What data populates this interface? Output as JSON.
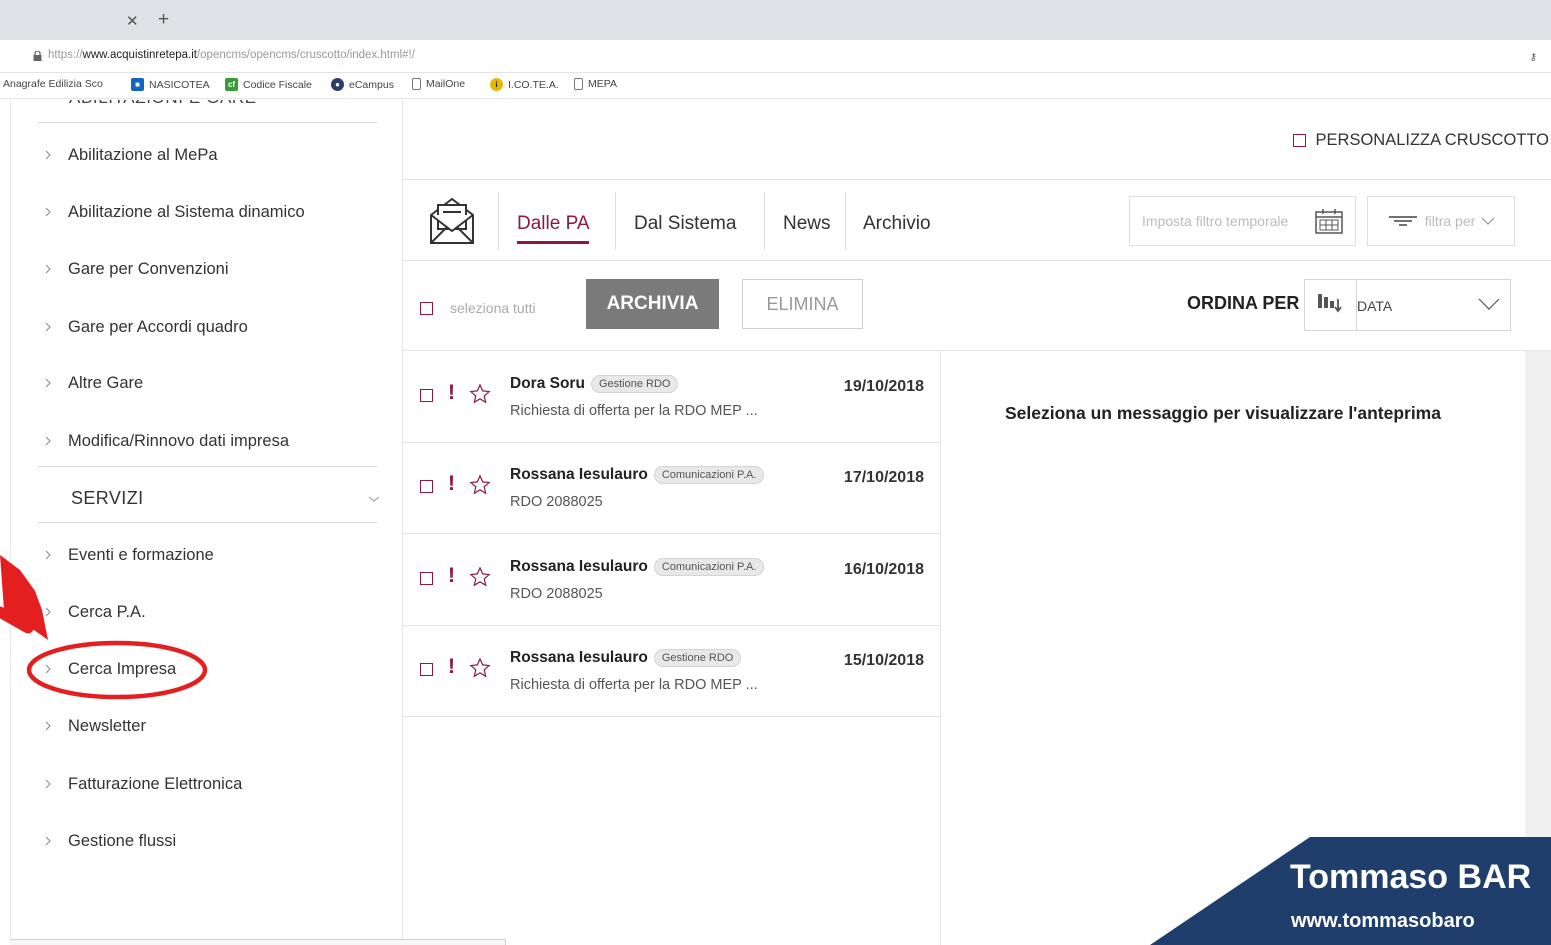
{
  "browser": {
    "url_prefix": "https://",
    "url_host": "www.acquistinretepa.it",
    "url_path": "/opencms/opencms/cruscotto/index.html#!/",
    "bookmarks": [
      {
        "label": "Anagrafe Edilizia Sco",
        "icon": "none"
      },
      {
        "label": "NASICOTEA",
        "icon": "nasicotea-icon"
      },
      {
        "label": "Codice Fiscale",
        "icon": "cf-icon"
      },
      {
        "label": "eCampus",
        "icon": "ecampus-icon"
      },
      {
        "label": "MailOne",
        "icon": "page-icon"
      },
      {
        "label": "I.CO.TE.A.",
        "icon": "icotea-icon"
      },
      {
        "label": "MEPA",
        "icon": "page-icon"
      }
    ]
  },
  "sidebar": {
    "cut_section": "ABILITAZIONI E GARE",
    "items_top": [
      "Abilitazione al MePa",
      "Abilitazione al Sistema dinamico",
      "Gare per Convenzioni",
      "Gare per Accordi quadro",
      "Altre Gare",
      "Modifica/Rinnovo dati impresa"
    ],
    "servizi_label": "SERVIZI",
    "items_servizi": [
      "Eventi e formazione",
      "Cerca P.A.",
      "Cerca Impresa",
      "Newsletter",
      "Fatturazione Elettronica",
      "Gestione flussi"
    ]
  },
  "header": {
    "personalizza": "PERSONALIZZA CRUSCOTTO"
  },
  "tabs": [
    "Dalle PA",
    "Dal Sistema",
    "News",
    "Archivio"
  ],
  "filters": {
    "time_placeholder": "Imposta filtro temporale",
    "filtra_label": "filtra per"
  },
  "actions": {
    "select_all": "seleziona tutti",
    "archive": "ARCHIVIA",
    "delete": "ELIMINA",
    "sort_label": "ORDINA PER",
    "sort_value": "DATA"
  },
  "messages": [
    {
      "sender": "Dora Soru",
      "badge": "Gestione RDO",
      "subject": "Richiesta di offerta per la RDO MEP ...",
      "date": "19/10/2018"
    },
    {
      "sender": "Rossana Iesulauro",
      "badge": "Comunicazioni P.A.",
      "subject": "RDO 2088025",
      "date": "17/10/2018"
    },
    {
      "sender": "Rossana Iesulauro",
      "badge": "Comunicazioni P.A.",
      "subject": "RDO 2088025",
      "date": "16/10/2018"
    },
    {
      "sender": "Rossana Iesulauro",
      "badge": "Gestione RDO",
      "subject": "Richiesta di offerta per la RDO MEP ...",
      "date": "15/10/2018"
    }
  ],
  "preview": {
    "empty_text": "Seleziona un messaggio per visualizzare l'anteprima"
  },
  "watermark": {
    "line1": "Tommaso BAR",
    "line2": "www.tommasobaro"
  },
  "colors": {
    "accent": "#8b1a3e",
    "archive_button": "#7a7a7a",
    "annotation_red": "#e41f1f",
    "watermark_bg": "#1f3e6c"
  }
}
